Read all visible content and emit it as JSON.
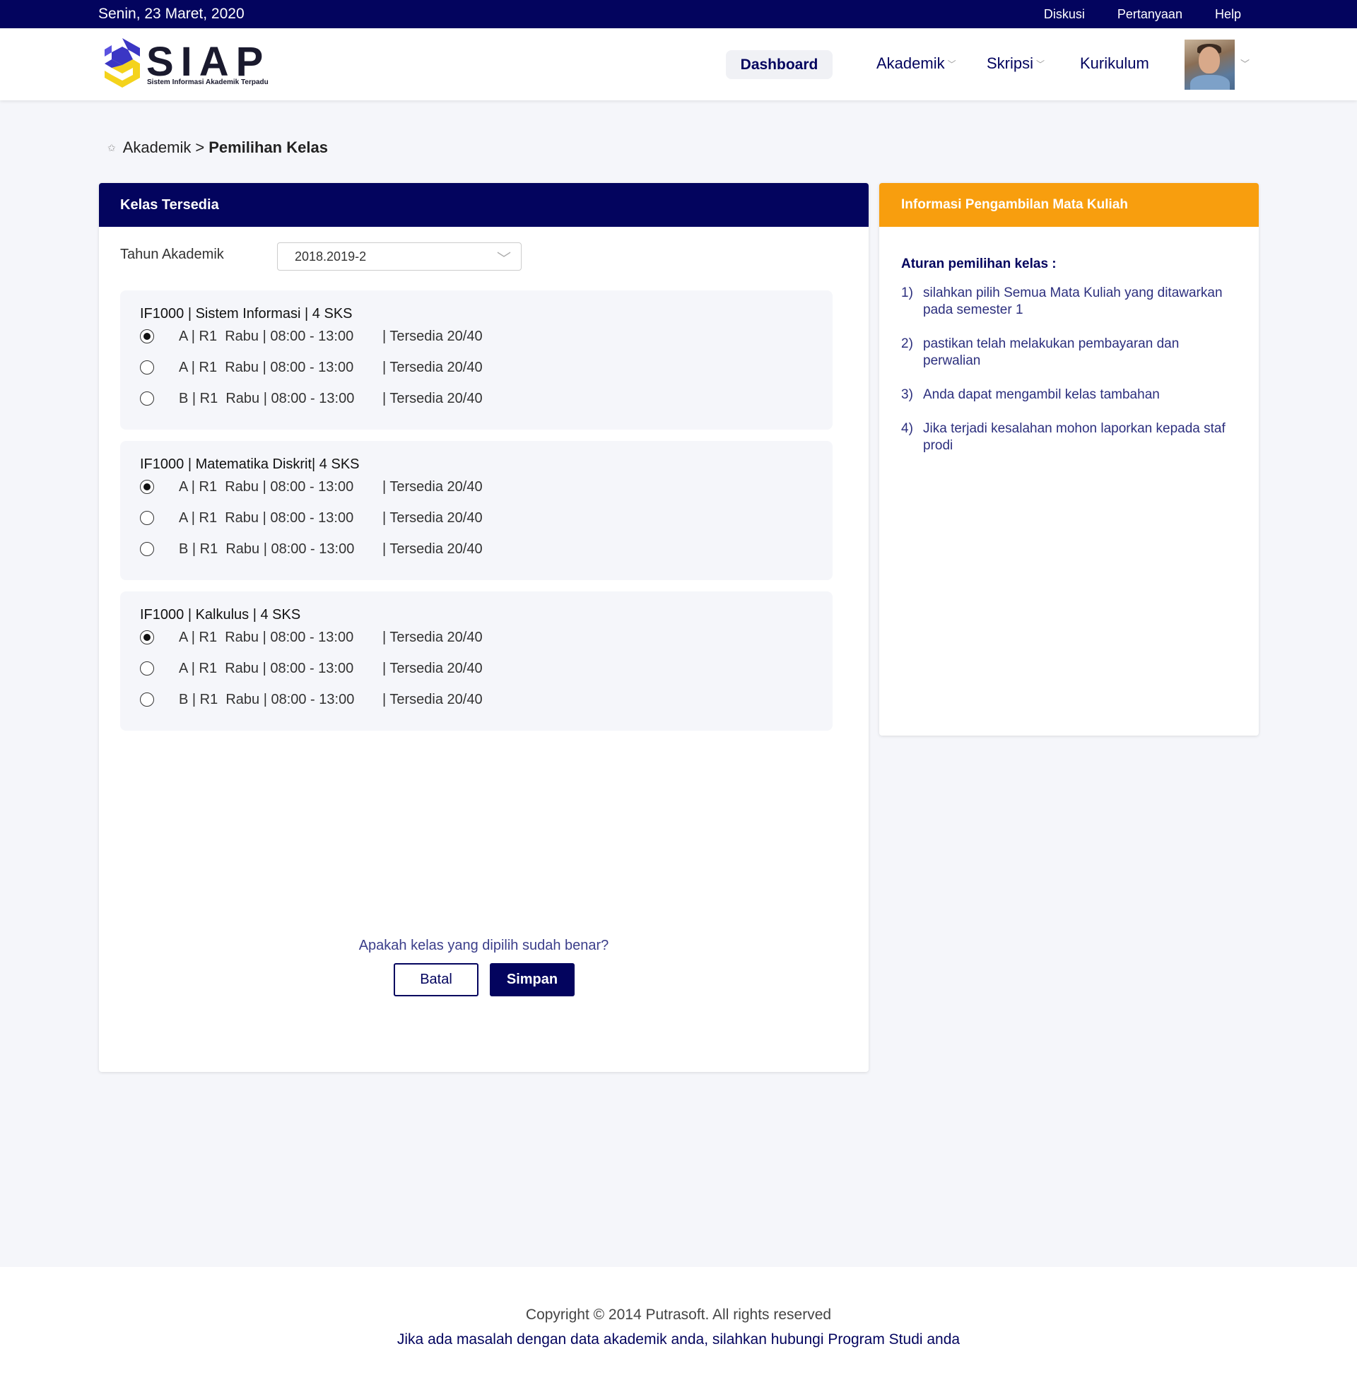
{
  "topbar": {
    "date": "Senin, 23 Maret, 2020",
    "links": [
      "Diskusi",
      "Pertanyaan",
      "Help"
    ]
  },
  "brand": {
    "name": "SIAP",
    "tagline": "Sistem Informasi Akademik Terpadu",
    "colors": {
      "primary": "#03045e",
      "accent": "#f89e0e",
      "logo_blue": "#3b36c4",
      "logo_yellow": "#f4d31c"
    }
  },
  "nav": {
    "dashboard": "Dashboard",
    "akademik": "Akademik",
    "skripsi": "Skripsi",
    "kurikulum": "Kurikulum"
  },
  "breadcrumb": {
    "parent": "Akademik",
    "separator": ">",
    "current": "Pemilihan Kelas"
  },
  "main": {
    "title": "Kelas Tersedia",
    "tahun_label": "Tahun Akademik",
    "tahun_value": "2018.2019-2",
    "courses": [
      {
        "title": "IF1000 | Sistem Informasi | 4 SKS",
        "options": [
          {
            "sched": "A | R1  Rabu | 08:00 - 13:00",
            "avail": "| Tersedia 20/40",
            "selected": true
          },
          {
            "sched": "A | R1  Rabu | 08:00 - 13:00",
            "avail": "| Tersedia 20/40",
            "selected": false
          },
          {
            "sched": "B | R1  Rabu | 08:00 - 13:00",
            "avail": "| Tersedia 20/40",
            "selected": false
          }
        ]
      },
      {
        "title": "IF1000 | Matematika Diskrit| 4 SKS",
        "options": [
          {
            "sched": "A | R1  Rabu | 08:00 - 13:00",
            "avail": "| Tersedia 20/40",
            "selected": true
          },
          {
            "sched": "A | R1  Rabu | 08:00 - 13:00",
            "avail": "| Tersedia 20/40",
            "selected": false
          },
          {
            "sched": "B | R1  Rabu | 08:00 - 13:00",
            "avail": "| Tersedia 20/40",
            "selected": false
          }
        ]
      },
      {
        "title": "IF1000 | Kalkulus | 4 SKS",
        "options": [
          {
            "sched": "A | R1  Rabu | 08:00 - 13:00",
            "avail": "| Tersedia 20/40",
            "selected": true
          },
          {
            "sched": "A | R1  Rabu | 08:00 - 13:00",
            "avail": "| Tersedia 20/40",
            "selected": false
          },
          {
            "sched": "B | R1  Rabu | 08:00 - 13:00",
            "avail": "| Tersedia 20/40",
            "selected": false
          }
        ]
      }
    ],
    "confirm_text": "Apakah kelas yang dipilih sudah benar?",
    "cancel_label": "Batal",
    "save_label": "Simpan"
  },
  "info": {
    "title": "Informasi Pengambilan Mata Kuliah",
    "rules_title": "Aturan pemilihan kelas :",
    "rules": [
      {
        "num": "1)",
        "text": "silahkan pilih Semua Mata Kuliah yang ditawarkan pada semester 1"
      },
      {
        "num": "2)",
        "text": "pastikan telah melakukan pembayaran dan perwalian"
      },
      {
        "num": "3)",
        "text": "Anda dapat mengambil kelas tambahan"
      },
      {
        "num": "4)",
        "text": "Jika terjadi kesalahan mohon laporkan kepada staf prodi"
      }
    ]
  },
  "footer": {
    "copyright": "Copyright © 2014 Putrasoft. All rights reserved",
    "help": "Jika ada masalah dengan data akademik anda, silahkan hubungi Program Studi anda"
  }
}
